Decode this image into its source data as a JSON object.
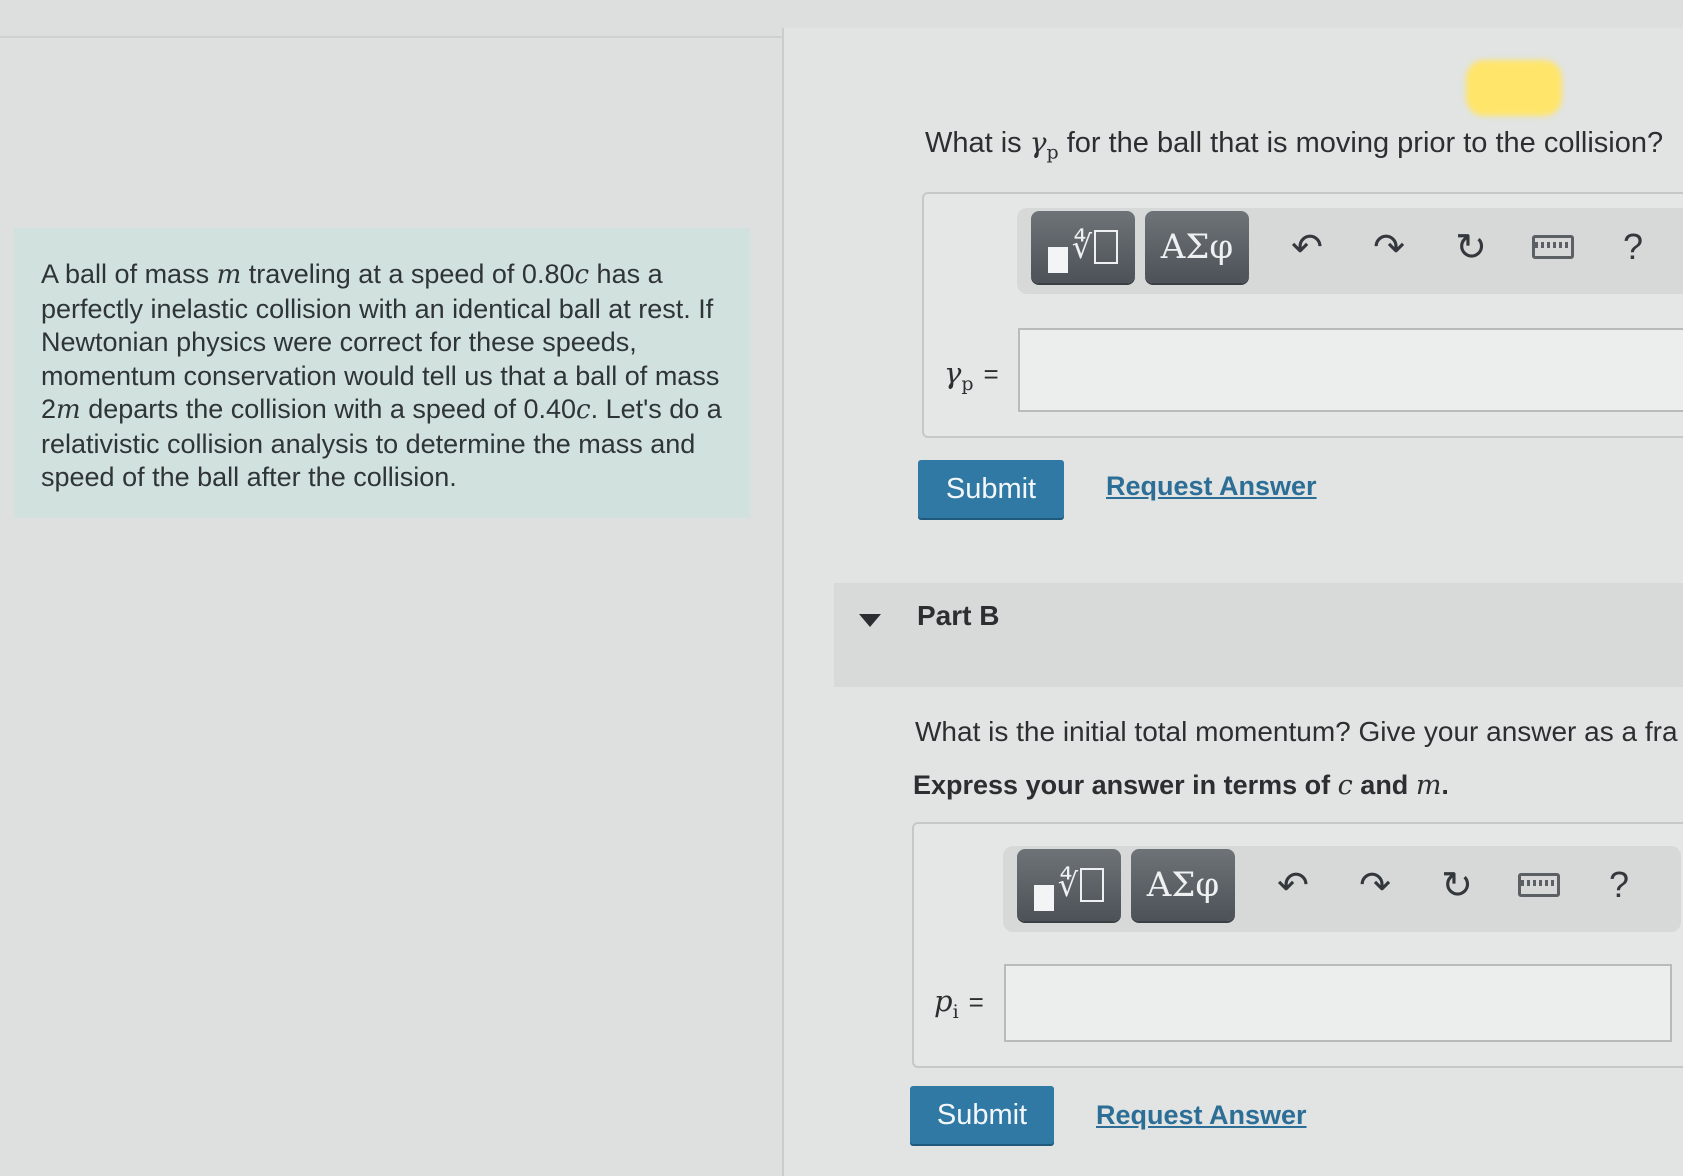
{
  "problem": {
    "text_parts": [
      "A ball of mass ",
      "m",
      " traveling at a speed of 0.80",
      "c",
      " has a perfectly inelastic collision with an identical ball at rest. If Newtonian physics were correct for these speeds, momentum conservation would tell us that a ball of mass 2",
      "m",
      " departs the collision with a speed of 0.40",
      "c",
      ". Let's do a relativistic collision analysis to determine the mass and speed of the ball after the collision."
    ]
  },
  "part_a": {
    "question_prefix": "What is ",
    "question_var": "γ",
    "question_sub": "p",
    "question_suffix": " for the ball that is moving prior to the collision?",
    "field_var": "γ",
    "field_sub": "p",
    "field_eq": "=",
    "input_value": "",
    "toolbar": {
      "templates_icon": "fraction-radical-template-icon",
      "symbols_label": "ΑΣφ",
      "undo_icon": "undo-icon",
      "redo_icon": "redo-icon",
      "reset_icon": "reset-icon",
      "keyboard_icon": "keyboard-icon",
      "help_label": "?"
    },
    "submit_label": "Submit",
    "request_label": "Request Answer"
  },
  "part_b": {
    "title": "Part B",
    "question": "What is the initial total momentum? Give your answer as a fra",
    "instruction_prefix": "Express your answer in terms of ",
    "instruction_var1": "c",
    "instruction_mid": " and ",
    "instruction_var2": "m",
    "instruction_suffix": ".",
    "field_var": "p",
    "field_sub": "i",
    "field_eq": "=",
    "input_value": "",
    "toolbar": {
      "templates_icon": "fraction-radical-template-icon",
      "symbols_label": "ΑΣφ",
      "undo_icon": "undo-icon",
      "redo_icon": "redo-icon",
      "reset_icon": "reset-icon",
      "keyboard_icon": "keyboard-icon",
      "help_label": "?"
    },
    "submit_label": "Submit",
    "request_label": "Request Answer"
  },
  "colors": {
    "problem_bg": "#d0e1de",
    "submit_bg": "#2f79a4",
    "link": "#2c6e96",
    "toolbar_button": "#565c61"
  }
}
